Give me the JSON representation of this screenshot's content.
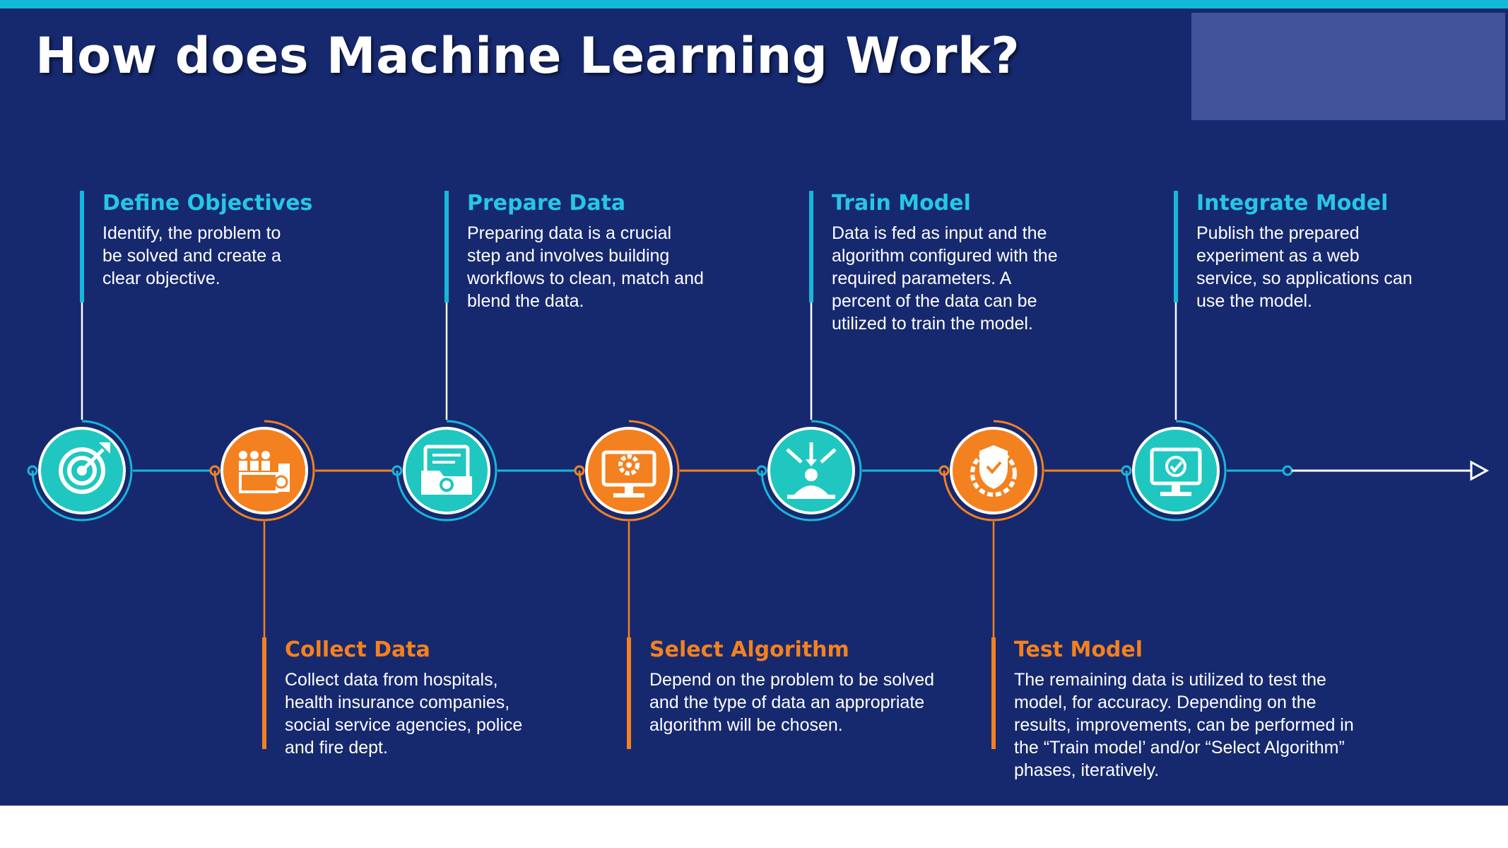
{
  "title": "How does Machine Learning Work?",
  "colors": {
    "background": "#16296f",
    "teal": "#18b7d9",
    "teal_node": "#1fc7c0",
    "orange": "#f4811f",
    "connector": "#ffffff"
  },
  "steps": [
    {
      "title": "Define Objectives",
      "description": "Identify, the problem to\nbe solved and create a\nclear objective.",
      "icon": "target-icon",
      "theme": "teal",
      "position": "above"
    },
    {
      "title": "Collect Data",
      "description": "Collect data from hospitals,\nhealth insurance companies,\nsocial service agencies, police\nand fire dept.",
      "icon": "data-collection-icon",
      "theme": "orange",
      "position": "below"
    },
    {
      "title": "Prepare Data",
      "description": "Preparing data is a crucial\nstep and involves building\nworkflows to clean, match and\nblend the data.",
      "icon": "data-folder-gear-icon",
      "theme": "teal",
      "position": "above"
    },
    {
      "title": "Select Algorithm",
      "description": "Depend on the problem to be solved\nand the type of data an appropriate\nalgorithm will be chosen.",
      "icon": "monitor-gear-icon",
      "theme": "orange",
      "position": "below"
    },
    {
      "title": "Train Model",
      "description": "Data is fed as input and the\nalgorithm configured with the\nrequired parameters. A\npercent of the data can be\nutilized to train the model.",
      "icon": "training-arrows-icon",
      "theme": "teal",
      "position": "above"
    },
    {
      "title": "Test Model",
      "description": "The remaining data is utilized to test the\nmodel, for accuracy. Depending on the\nresults, improvements, can be performed in\nthe “Train model’ and/or “Select Algorithm”\nphases, iteratively.",
      "icon": "test-shield-gear-icon",
      "theme": "orange",
      "position": "below"
    },
    {
      "title": "Integrate Model",
      "description": "Publish the prepared\nexperiment as a web\nservice, so applications can\nuse the model.",
      "icon": "monitor-check-icon",
      "theme": "teal",
      "position": "above"
    }
  ]
}
